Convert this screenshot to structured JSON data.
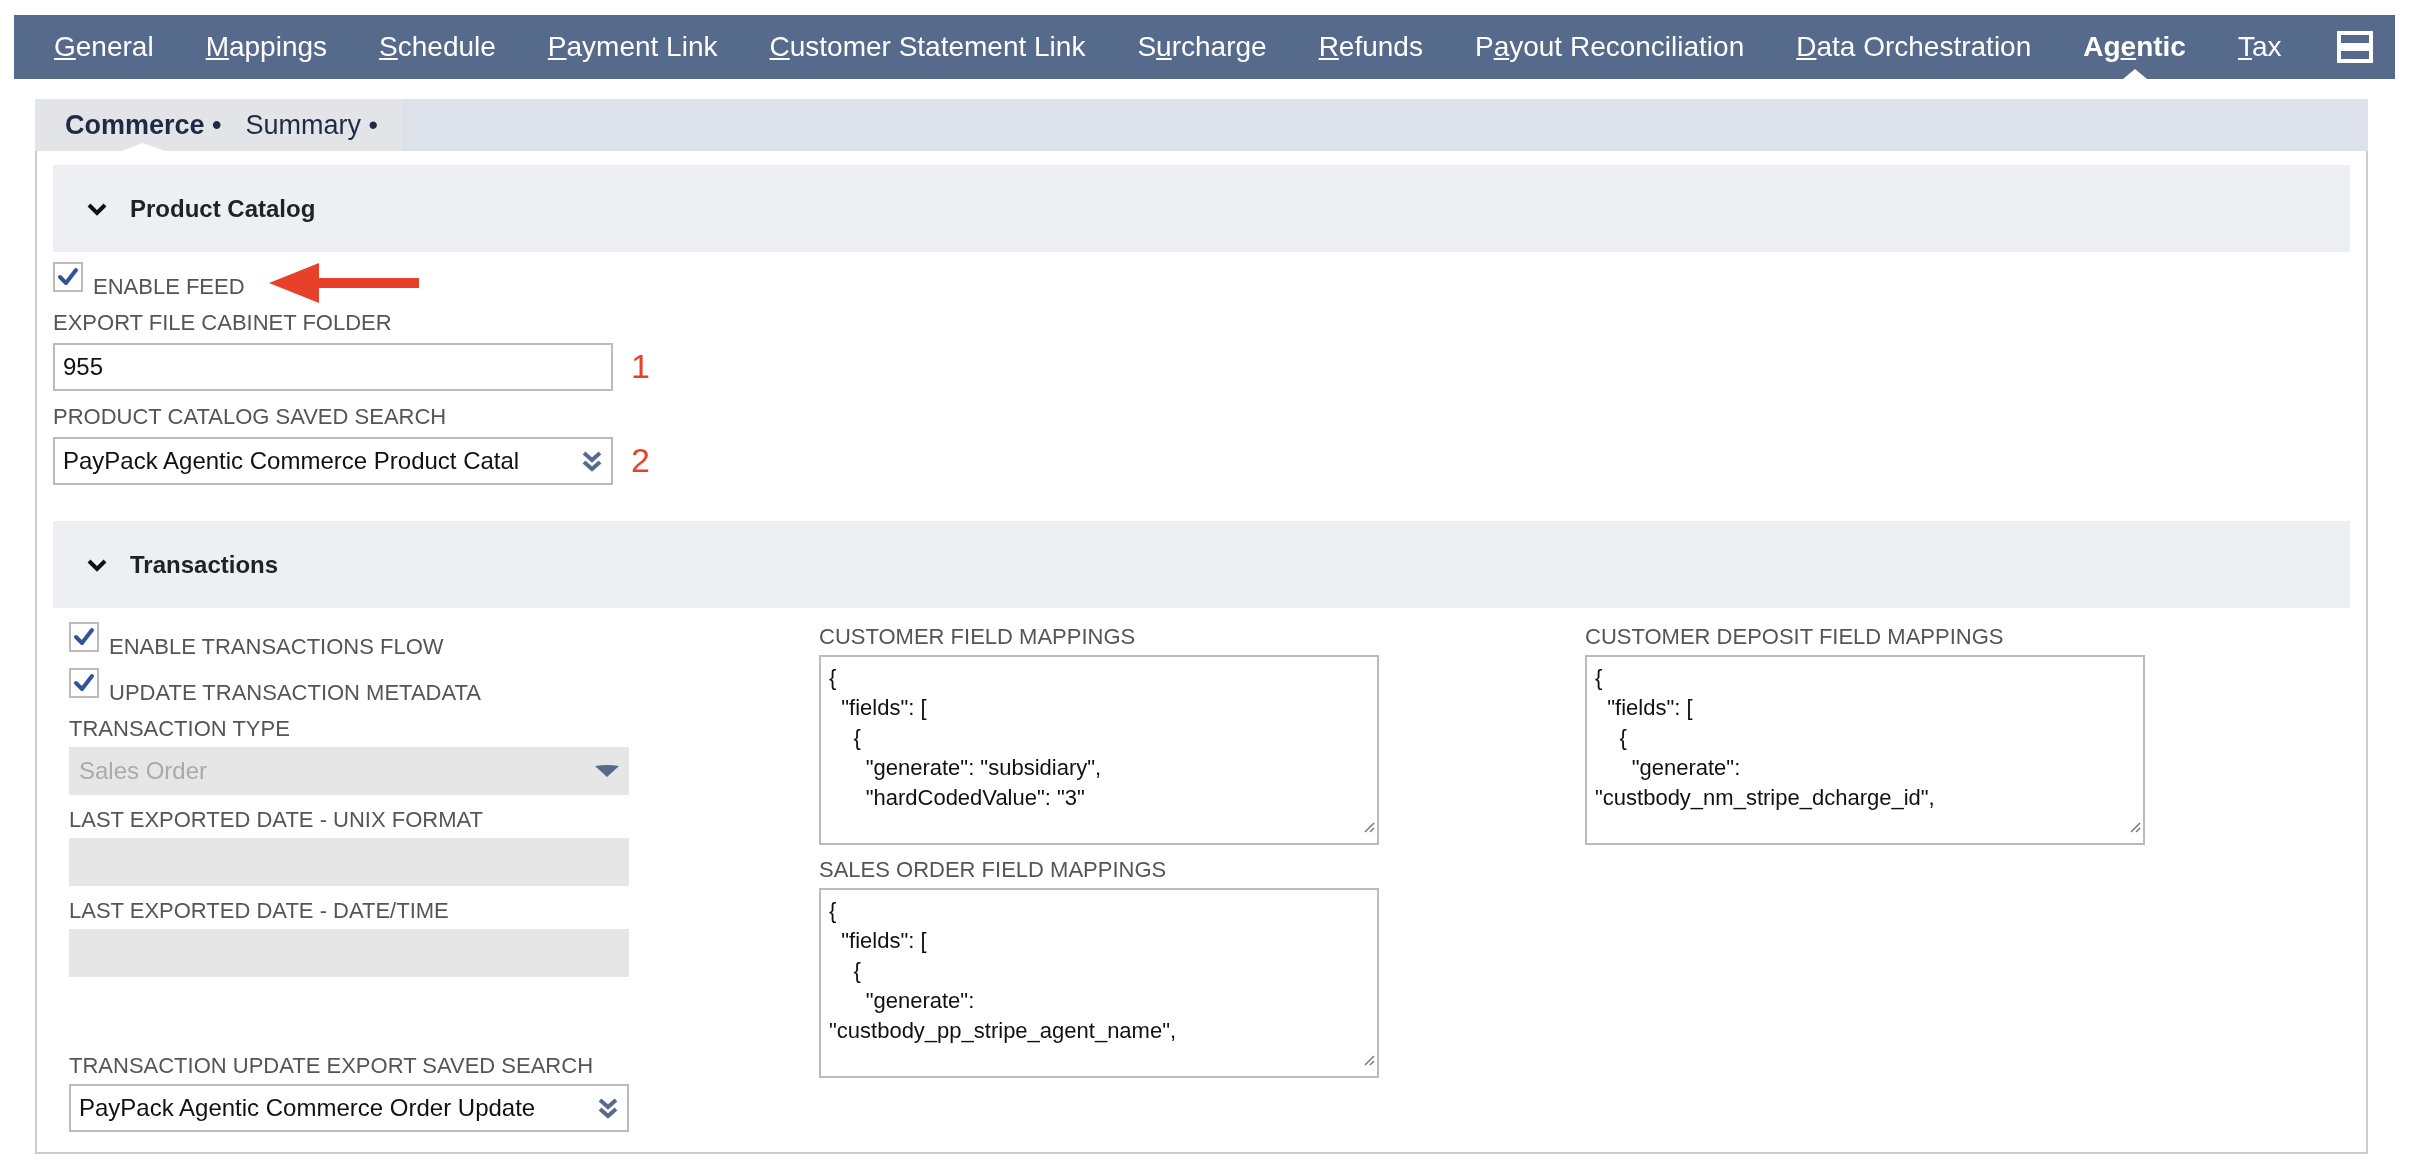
{
  "top_tabs": [
    {
      "access_key": "G",
      "label_end": "eneral",
      "selected": false
    },
    {
      "access_key": "M",
      "label_end": "appings",
      "selected": false
    },
    {
      "access_key": "S",
      "label_end": "chedule",
      "selected": false
    },
    {
      "access_key": "P",
      "label_end": "ayment Link",
      "selected": false
    },
    {
      "access_key": "C",
      "label_end": "ustomer Statement Link",
      "selected": false
    },
    {
      "label_start": "S",
      "access_key": "u",
      "label_end": "rcharge",
      "selected": false
    },
    {
      "access_key": "R",
      "label_end": "efunds",
      "selected": false
    },
    {
      "label_start": "P",
      "access_key": "a",
      "label_end": "yout Reconciliation",
      "selected": false
    },
    {
      "access_key": "D",
      "label_end": "ata Orchestration",
      "selected": false
    },
    {
      "label_start": "Ag",
      "access_key": "e",
      "label_end": "ntic",
      "selected": true
    },
    {
      "access_key": "T",
      "label_end": "ax",
      "selected": false
    }
  ],
  "subtabs": [
    {
      "label": "Commerce •",
      "selected": true
    },
    {
      "label": "Summary •",
      "selected": false
    }
  ],
  "sections": [
    {
      "title": "Product Catalog",
      "expanded": true,
      "columns": [
        [
          {
            "kind": "checkbox",
            "label": "ENABLE FEED",
            "checked": true,
            "annotated": true
          },
          {
            "kind": "text",
            "label": "EXPORT FILE CABINET FOLDER",
            "value": "955",
            "disabled": false,
            "marker": "1"
          },
          {
            "kind": "popup",
            "label": "PRODUCT CATALOG SAVED SEARCH",
            "value": "PayPack Agentic Commerce Product Catal",
            "disabled": false,
            "marker": "2"
          }
        ]
      ]
    },
    {
      "title": "Transactions",
      "expanded": true,
      "columns": [
        [
          {
            "kind": "checkbox",
            "label": "ENABLE TRANSACTIONS FLOW",
            "checked": true,
            "annotated": false
          },
          {
            "kind": "checkbox",
            "label": "UPDATE TRANSACTION METADATA",
            "checked": true,
            "annotated": false
          },
          {
            "kind": "dropdown",
            "label": "TRANSACTION TYPE",
            "value": "Sales Order",
            "disabled": true
          },
          {
            "kind": "text",
            "label": "LAST EXPORTED DATE - UNIX FORMAT",
            "disabled": true
          },
          {
            "kind": "text",
            "label": "LAST EXPORTED DATE - DATE/TIME",
            "disabled": true
          },
          {
            "kind": "popup",
            "label": "TRANSACTION UPDATE EXPORT SAVED SEARCH",
            "value": "PayPack Agentic Commerce Order Update",
            "disabled": false
          }
        ],
        [
          {
            "kind": "json",
            "label": "CUSTOMER FIELD MAPPINGS",
            "value": "{\n  \"fields\": [\n    {\n      \"generate\": \"subsidiary\",\n      \"hardCodedValue\": \"3\""
          },
          {
            "kind": "json",
            "label": "SALES ORDER FIELD MAPPINGS",
            "value": "{\n  \"fields\": [\n    {\n      \"generate\":\n\"custbody_pp_stripe_agent_name\","
          }
        ],
        [
          {
            "kind": "json",
            "label": "CUSTOMER DEPOSIT FIELD MAPPINGS",
            "value": "{\n  \"fields\": [\n    {\n      \"generate\":\n\"custbody_nm_stripe_dcharge_id\","
          }
        ]
      ]
    }
  ]
}
